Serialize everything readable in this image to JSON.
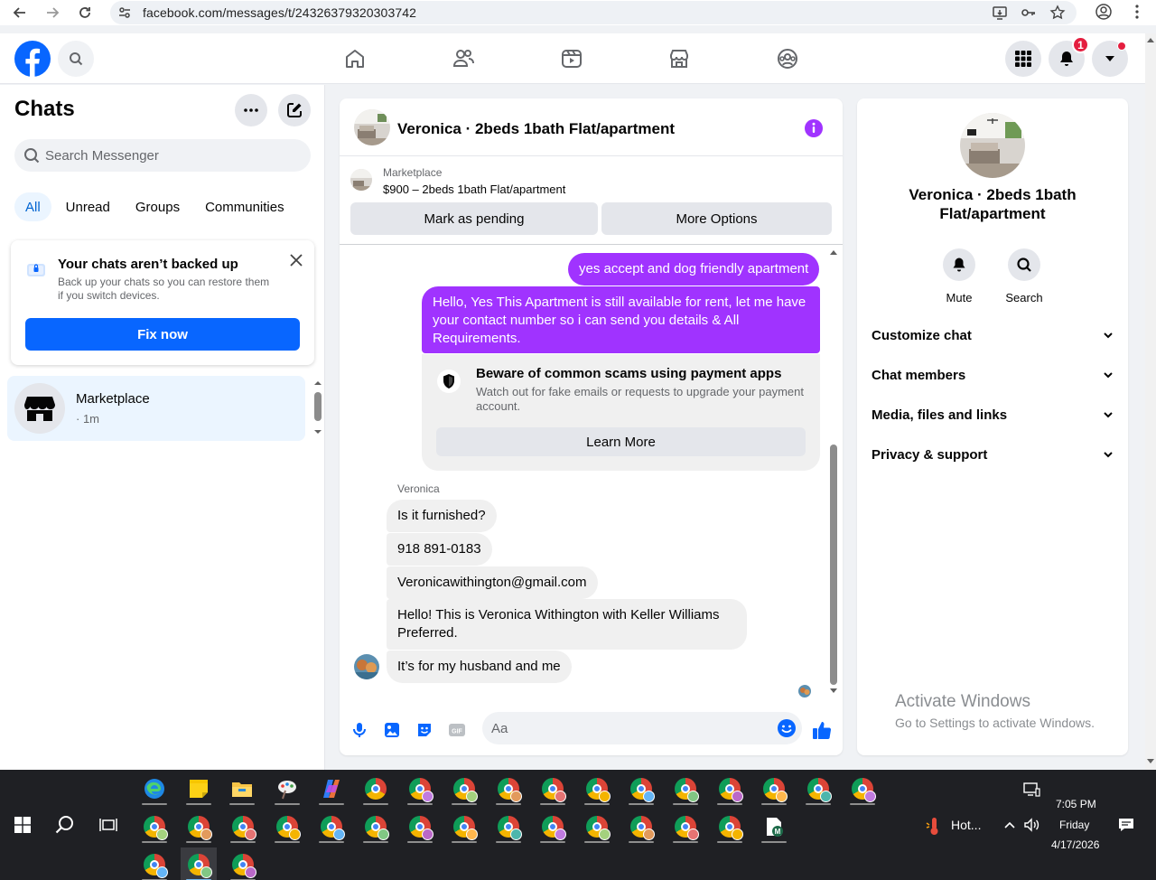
{
  "browser": {
    "url": "facebook.com/messages/t/24326379320303742"
  },
  "header": {
    "notification_count": "1"
  },
  "sidebar": {
    "title": "Chats",
    "search_placeholder": "Search Messenger",
    "tabs": [
      {
        "label": "All",
        "active": true
      },
      {
        "label": "Unread",
        "active": false
      },
      {
        "label": "Groups",
        "active": false
      },
      {
        "label": "Communities",
        "active": false
      }
    ],
    "backup": {
      "title": "Your chats aren’t backed up",
      "body": "Back up your chats so you can restore them if you switch devices.",
      "button": "Fix now"
    },
    "chat": {
      "name": "Marketplace",
      "time": "· 1m"
    }
  },
  "conversation": {
    "title": "Veronica · 2beds 1bath Flat/apartment",
    "marketplace_label": "Marketplace",
    "listing": "$900 – 2beds 1bath Flat/apartment",
    "pending_button": "Mark as pending",
    "options_button": "More Options",
    "outgoing": [
      "yes accept and dog friendly apartment",
      "Hello, Yes This Apartment is still available for rent, let me have your contact number so i can send you details & All Requirements."
    ],
    "warning": {
      "title": "Beware of common scams using payment apps",
      "body": "Watch out for fake emails or requests to upgrade your payment account.",
      "button": "Learn More"
    },
    "sender": "Veronica",
    "incoming": [
      "Is it furnished?",
      "918 891-0183",
      "Veronicawithington@gmail.com",
      "Hello!   This is Veronica Withington with Keller Williams Preferred.",
      "It’s for my husband and me"
    ],
    "composer_placeholder": "Aa"
  },
  "details": {
    "title": "Veronica · 2beds 1bath Flat/apartment",
    "actions": [
      "Mute",
      "Search"
    ],
    "sections": [
      "Customize chat",
      "Chat members",
      "Media, files and links",
      "Privacy & support"
    ]
  },
  "watermark": {
    "line1": "Activate Windows",
    "line2": "Go to Settings to activate Windows."
  },
  "taskbar": {
    "weather": "Hot...",
    "time": "7:05 PM",
    "day": "Friday",
    "date": "4/17/2026"
  },
  "colors": {
    "facebook_blue": "#0866ff",
    "messenger_purple": "#a033ff",
    "badge_red": "#e41e3f"
  }
}
